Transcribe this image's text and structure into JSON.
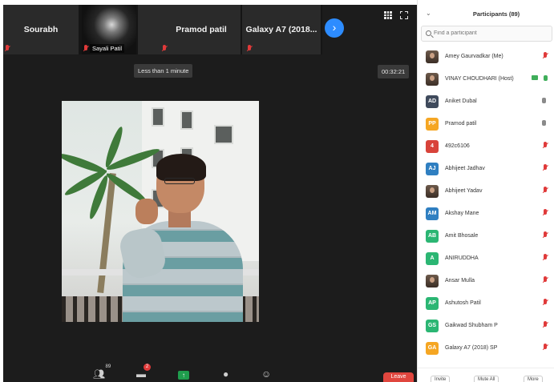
{
  "meeting": {
    "top_strip": {
      "tiles": [
        {
          "name": "Sourabh",
          "muted": true
        },
        {
          "name": "Sayali Patil",
          "muted": true
        },
        {
          "name": "Pramod patil",
          "muted": true
        },
        {
          "name": "Galaxy A7 (2018...",
          "muted": true
        }
      ]
    },
    "duration_badge": "Less than 1 minute",
    "recording_timer": "00:32:21",
    "toolbar": {
      "participants_count": "89",
      "chat_unread": "2",
      "leave_label": "Leave"
    }
  },
  "participants_panel": {
    "title": "Participants (89)",
    "search_placeholder": "Find a participant",
    "items": [
      {
        "name": "Amey Gaurvadkar (Me)",
        "avatar": "photo",
        "color": "#5a4a3e",
        "status": "muted"
      },
      {
        "name": "VINAY CHOUDHARI (Host)",
        "avatar": "photo",
        "color": "#8c7a6b",
        "status": "host-live"
      },
      {
        "name": "Aniket Dubal",
        "avatar": "AD",
        "color": "#3f4a5c",
        "status": "mic"
      },
      {
        "name": "Pramod patil",
        "avatar": "PP",
        "color": "#f5a623",
        "status": "mic"
      },
      {
        "name": "492c6106",
        "avatar": "4",
        "color": "#d8433a",
        "status": "muted"
      },
      {
        "name": "Abhijeet Jadhav",
        "avatar": "AJ",
        "color": "#2f7fc1",
        "status": "muted"
      },
      {
        "name": "Abhijeet Yadav",
        "avatar": "photo",
        "color": "#7a6a5d",
        "status": "muted"
      },
      {
        "name": "Akshay Mane",
        "avatar": "AM",
        "color": "#2f7fc1",
        "status": "muted"
      },
      {
        "name": "Amit Bhosale",
        "avatar": "AB",
        "color": "#2bb673",
        "status": "muted"
      },
      {
        "name": "ANIRUDDHA",
        "avatar": "A",
        "color": "#2bb673",
        "status": "muted"
      },
      {
        "name": "Ansar Mulla",
        "avatar": "photo",
        "color": "#6b5a4d",
        "status": "muted"
      },
      {
        "name": "Ashutosh Patil",
        "avatar": "AP",
        "color": "#2bb673",
        "status": "muted"
      },
      {
        "name": "Gaikwad Shubham P",
        "avatar": "GS",
        "color": "#2bb673",
        "status": "muted"
      },
      {
        "name": "Galaxy A7 (2018) SP",
        "avatar": "GA",
        "color": "#f5a623",
        "status": "muted"
      }
    ],
    "footer_buttons": [
      "Invite",
      "Mute All",
      "More"
    ]
  }
}
